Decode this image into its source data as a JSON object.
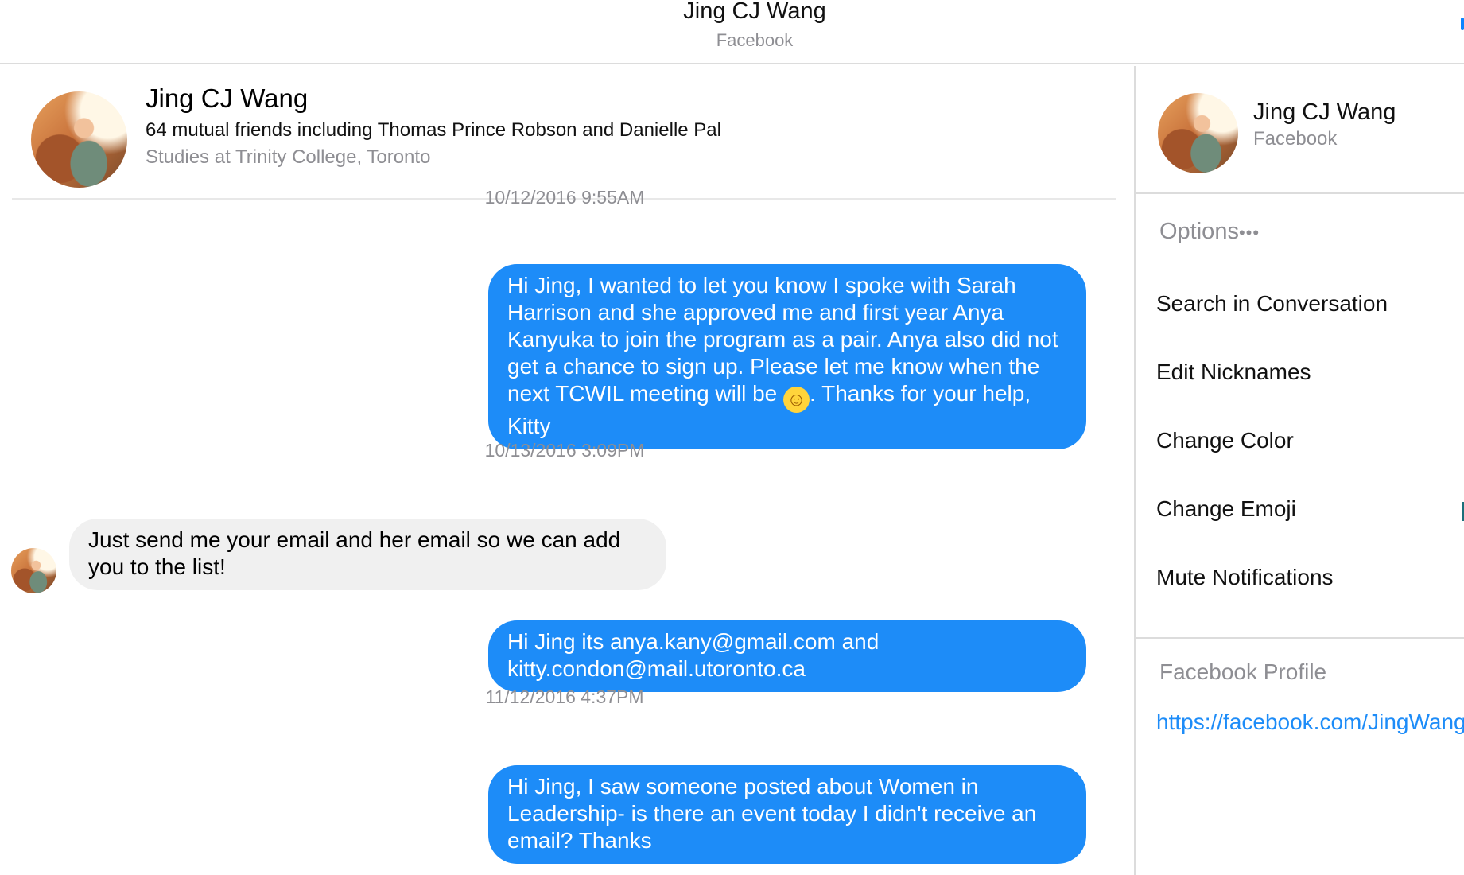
{
  "window": {
    "title": "Jing CJ Wang",
    "subtitle": "Facebook"
  },
  "contact": {
    "name": "Jing CJ Wang",
    "mutual_friends": "64 mutual friends including Thomas Prince Robson and Danielle Pal",
    "studies": "Studies at Trinity College, Toronto"
  },
  "messages": [
    {
      "type": "timestamp",
      "text": "10/12/2016 9:55AM"
    },
    {
      "type": "outgoing",
      "text_before_emoji": "Hi Jing, I wanted to let you know I spoke with Sarah Harrison and she approved me and first year Anya Kanyuka to join the program as a pair. Anya also did not get a chance to sign up. Please let me know when the next TCWIL meeting will be ",
      "emoji": "☺",
      "text_after_emoji": ". Thanks for your help, Kitty"
    },
    {
      "type": "timestamp",
      "text": "10/13/2016 3:09PM"
    },
    {
      "type": "incoming",
      "text": "Just send me your email and her email so we can add you to the list!"
    },
    {
      "type": "outgoing",
      "text": "Hi Jing its anya.kany@gmail.com and kitty.condon@mail.utoronto.ca"
    },
    {
      "type": "timestamp",
      "text": "11/12/2016 4:37PM"
    },
    {
      "type": "outgoing",
      "text": "Hi Jing, I saw someone posted about Women in Leadership- is there an event today I didn't receive an email? Thanks"
    }
  ],
  "panel": {
    "name": "Jing CJ Wang",
    "source": "Facebook",
    "options_label": "Options",
    "options_more": "•••",
    "options": [
      "Search in Conversation",
      "Edit Nicknames",
      "Change Color",
      "Change Emoji",
      "Mute Notifications"
    ],
    "profile_label": "Facebook Profile",
    "profile_link": "https://facebook.com/JingWang"
  },
  "colors": {
    "outgoing_bubble": "#1d8cf8",
    "incoming_bubble": "#f0f0f0",
    "muted_text": "#8e8e93",
    "link": "#1d8cf8"
  },
  "icons": {
    "contact_avatar": "profile-photo",
    "options_more": "ellipsis-icon"
  }
}
